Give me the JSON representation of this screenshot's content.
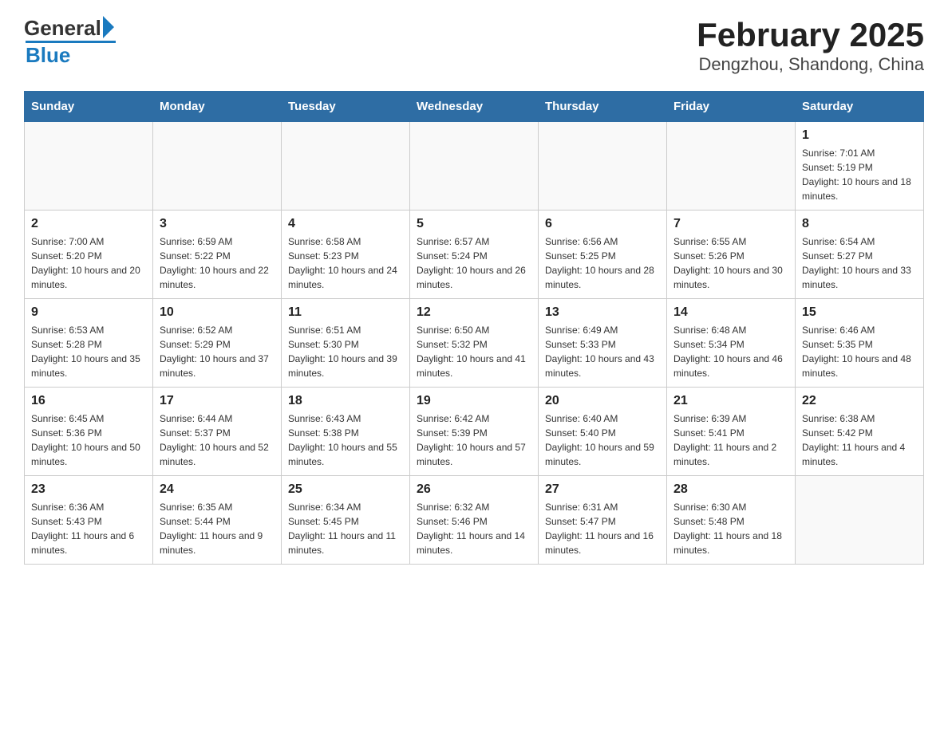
{
  "header": {
    "title": "February 2025",
    "subtitle": "Dengzhou, Shandong, China",
    "logo_general": "General",
    "logo_blue": "Blue"
  },
  "weekdays": [
    "Sunday",
    "Monday",
    "Tuesday",
    "Wednesday",
    "Thursday",
    "Friday",
    "Saturday"
  ],
  "weeks": [
    [
      {
        "day": "",
        "info": ""
      },
      {
        "day": "",
        "info": ""
      },
      {
        "day": "",
        "info": ""
      },
      {
        "day": "",
        "info": ""
      },
      {
        "day": "",
        "info": ""
      },
      {
        "day": "",
        "info": ""
      },
      {
        "day": "1",
        "info": "Sunrise: 7:01 AM\nSunset: 5:19 PM\nDaylight: 10 hours and 18 minutes."
      }
    ],
    [
      {
        "day": "2",
        "info": "Sunrise: 7:00 AM\nSunset: 5:20 PM\nDaylight: 10 hours and 20 minutes."
      },
      {
        "day": "3",
        "info": "Sunrise: 6:59 AM\nSunset: 5:22 PM\nDaylight: 10 hours and 22 minutes."
      },
      {
        "day": "4",
        "info": "Sunrise: 6:58 AM\nSunset: 5:23 PM\nDaylight: 10 hours and 24 minutes."
      },
      {
        "day": "5",
        "info": "Sunrise: 6:57 AM\nSunset: 5:24 PM\nDaylight: 10 hours and 26 minutes."
      },
      {
        "day": "6",
        "info": "Sunrise: 6:56 AM\nSunset: 5:25 PM\nDaylight: 10 hours and 28 minutes."
      },
      {
        "day": "7",
        "info": "Sunrise: 6:55 AM\nSunset: 5:26 PM\nDaylight: 10 hours and 30 minutes."
      },
      {
        "day": "8",
        "info": "Sunrise: 6:54 AM\nSunset: 5:27 PM\nDaylight: 10 hours and 33 minutes."
      }
    ],
    [
      {
        "day": "9",
        "info": "Sunrise: 6:53 AM\nSunset: 5:28 PM\nDaylight: 10 hours and 35 minutes."
      },
      {
        "day": "10",
        "info": "Sunrise: 6:52 AM\nSunset: 5:29 PM\nDaylight: 10 hours and 37 minutes."
      },
      {
        "day": "11",
        "info": "Sunrise: 6:51 AM\nSunset: 5:30 PM\nDaylight: 10 hours and 39 minutes."
      },
      {
        "day": "12",
        "info": "Sunrise: 6:50 AM\nSunset: 5:32 PM\nDaylight: 10 hours and 41 minutes."
      },
      {
        "day": "13",
        "info": "Sunrise: 6:49 AM\nSunset: 5:33 PM\nDaylight: 10 hours and 43 minutes."
      },
      {
        "day": "14",
        "info": "Sunrise: 6:48 AM\nSunset: 5:34 PM\nDaylight: 10 hours and 46 minutes."
      },
      {
        "day": "15",
        "info": "Sunrise: 6:46 AM\nSunset: 5:35 PM\nDaylight: 10 hours and 48 minutes."
      }
    ],
    [
      {
        "day": "16",
        "info": "Sunrise: 6:45 AM\nSunset: 5:36 PM\nDaylight: 10 hours and 50 minutes."
      },
      {
        "day": "17",
        "info": "Sunrise: 6:44 AM\nSunset: 5:37 PM\nDaylight: 10 hours and 52 minutes."
      },
      {
        "day": "18",
        "info": "Sunrise: 6:43 AM\nSunset: 5:38 PM\nDaylight: 10 hours and 55 minutes."
      },
      {
        "day": "19",
        "info": "Sunrise: 6:42 AM\nSunset: 5:39 PM\nDaylight: 10 hours and 57 minutes."
      },
      {
        "day": "20",
        "info": "Sunrise: 6:40 AM\nSunset: 5:40 PM\nDaylight: 10 hours and 59 minutes."
      },
      {
        "day": "21",
        "info": "Sunrise: 6:39 AM\nSunset: 5:41 PM\nDaylight: 11 hours and 2 minutes."
      },
      {
        "day": "22",
        "info": "Sunrise: 6:38 AM\nSunset: 5:42 PM\nDaylight: 11 hours and 4 minutes."
      }
    ],
    [
      {
        "day": "23",
        "info": "Sunrise: 6:36 AM\nSunset: 5:43 PM\nDaylight: 11 hours and 6 minutes."
      },
      {
        "day": "24",
        "info": "Sunrise: 6:35 AM\nSunset: 5:44 PM\nDaylight: 11 hours and 9 minutes."
      },
      {
        "day": "25",
        "info": "Sunrise: 6:34 AM\nSunset: 5:45 PM\nDaylight: 11 hours and 11 minutes."
      },
      {
        "day": "26",
        "info": "Sunrise: 6:32 AM\nSunset: 5:46 PM\nDaylight: 11 hours and 14 minutes."
      },
      {
        "day": "27",
        "info": "Sunrise: 6:31 AM\nSunset: 5:47 PM\nDaylight: 11 hours and 16 minutes."
      },
      {
        "day": "28",
        "info": "Sunrise: 6:30 AM\nSunset: 5:48 PM\nDaylight: 11 hours and 18 minutes."
      },
      {
        "day": "",
        "info": ""
      }
    ]
  ]
}
